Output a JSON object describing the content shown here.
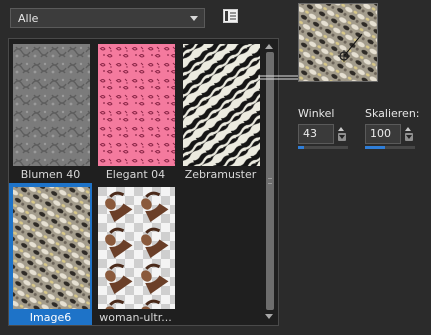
{
  "category": {
    "value": "Alle"
  },
  "gallery": {
    "items": [
      {
        "label": "Blumen 40",
        "selected": false
      },
      {
        "label": "Elegant 04",
        "selected": false
      },
      {
        "label": "Zebramuster",
        "selected": false
      },
      {
        "label": "Image6",
        "selected": true
      },
      {
        "label": "woman-ultr...",
        "selected": false
      }
    ],
    "scroll_position": 0.0
  },
  "winkel": {
    "label": "Winkel",
    "value": "43",
    "level": 0.12
  },
  "skalieren": {
    "label": "Skalieren:",
    "value": "100",
    "level": 0.4
  },
  "icons": {
    "dropdown": "chevron-down-icon",
    "view": "list-view-icon",
    "spin_up": "arrow-up-icon",
    "spin_menu": "dropdown-icon"
  },
  "colors": {
    "accent": "#1e73c8",
    "background": "#2b2b2b",
    "selected_tile": "#1e73c8",
    "pink": "#f47a9e"
  }
}
